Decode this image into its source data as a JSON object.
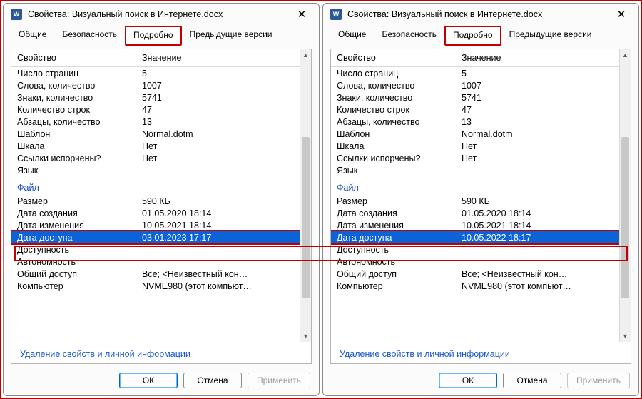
{
  "windows": [
    {
      "title": "Свойства: Визуальный поиск в Интернете.docx",
      "tabs": [
        "Общие",
        "Безопасность",
        "Подробно",
        "Предыдущие версии"
      ],
      "activeTab": "Подробно",
      "columns": {
        "prop": "Свойство",
        "val": "Значение"
      },
      "topRows": [
        {
          "p": "Число страниц",
          "v": "5"
        },
        {
          "p": "Слова, количество",
          "v": "1007"
        },
        {
          "p": "Знаки, количество",
          "v": "5741"
        },
        {
          "p": "Количество строк",
          "v": "47"
        },
        {
          "p": "Абзацы, количество",
          "v": "13"
        },
        {
          "p": "Шаблон",
          "v": "Normal.dotm"
        },
        {
          "p": "Шкала",
          "v": "Нет"
        },
        {
          "p": "Ссылки испорчены?",
          "v": "Нет"
        },
        {
          "p": "Язык",
          "v": ""
        }
      ],
      "sectionLabel": "Файл",
      "fileRows": [
        {
          "p": "Размер",
          "v": "590 КБ"
        },
        {
          "p": "Дата создания",
          "v": "01.05.2020 18:14"
        },
        {
          "p": "Дата изменения",
          "v": "10.05.2021 18:14"
        },
        {
          "p": "Дата доступа",
          "v": "03.01.2023 17:17",
          "selected": true
        },
        {
          "p": "Доступность",
          "v": ""
        },
        {
          "p": "Автономность",
          "v": ""
        },
        {
          "p": "Общий доступ",
          "v": "Все; <Неизвестный кон…"
        },
        {
          "p": "Компьютер",
          "v": "NVME980 (этот компьют…"
        }
      ],
      "removeLink": "Удаление свойств и личной информации",
      "buttons": {
        "ok": "ОК",
        "cancel": "Отмена",
        "apply": "Применить"
      }
    },
    {
      "title": "Свойства: Визуальный поиск в Интернете.docx",
      "tabs": [
        "Общие",
        "Безопасность",
        "Подробно",
        "Предыдущие версии"
      ],
      "activeTab": "Подробно",
      "columns": {
        "prop": "Свойство",
        "val": "Значение"
      },
      "topRows": [
        {
          "p": "Число страниц",
          "v": "5"
        },
        {
          "p": "Слова, количество",
          "v": "1007"
        },
        {
          "p": "Знаки, количество",
          "v": "5741"
        },
        {
          "p": "Количество строк",
          "v": "47"
        },
        {
          "p": "Абзацы, количество",
          "v": "13"
        },
        {
          "p": "Шаблон",
          "v": "Normal.dotm"
        },
        {
          "p": "Шкала",
          "v": "Нет"
        },
        {
          "p": "Ссылки испорчены?",
          "v": "Нет"
        },
        {
          "p": "Язык",
          "v": ""
        }
      ],
      "sectionLabel": "Файл",
      "fileRows": [
        {
          "p": "Размер",
          "v": "590 КБ"
        },
        {
          "p": "Дата создания",
          "v": "01.05.2020 18:14"
        },
        {
          "p": "Дата изменения",
          "v": "10.05.2021 18:14"
        },
        {
          "p": "Дата доступа",
          "v": "10.05.2022 18:17",
          "selected": true
        },
        {
          "p": "Доступность",
          "v": ""
        },
        {
          "p": "Автономность",
          "v": ""
        },
        {
          "p": "Общий доступ",
          "v": "Все; <Неизвестный кон…"
        },
        {
          "p": "Компьютер",
          "v": "NVME980 (этот компьют…"
        }
      ],
      "removeLink": "Удаление свойств и личной информации",
      "buttons": {
        "ok": "ОК",
        "cancel": "Отмена",
        "apply": "Применить"
      }
    }
  ]
}
